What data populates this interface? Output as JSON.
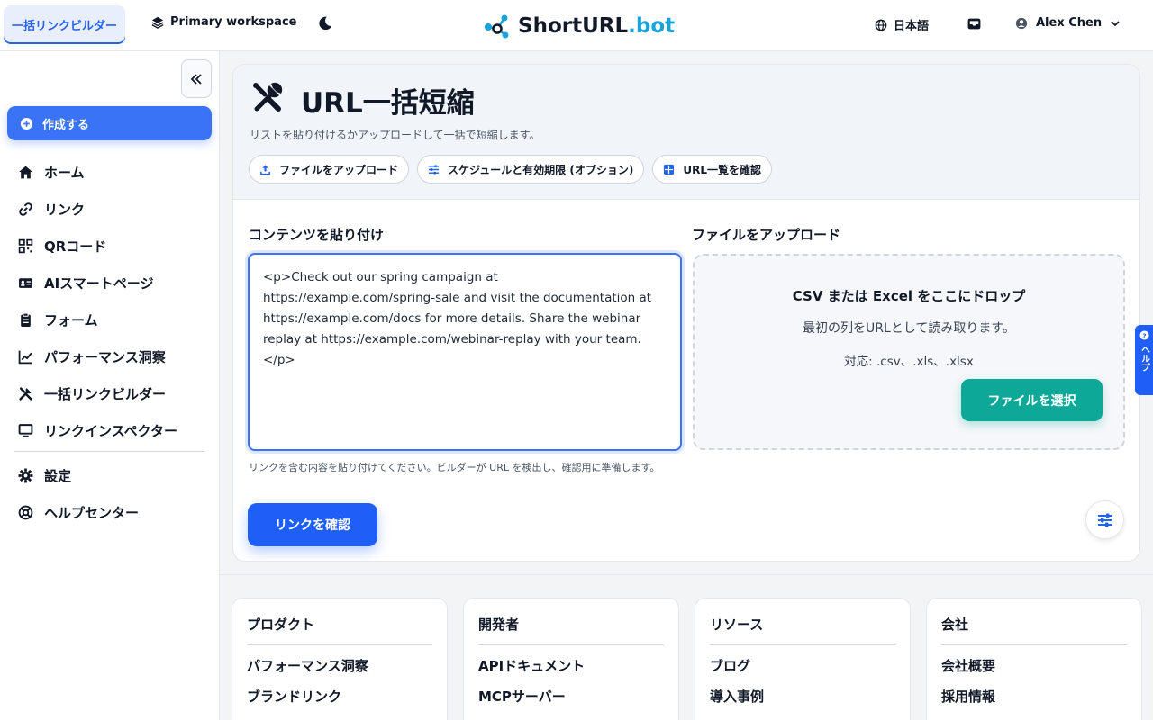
{
  "topbar": {
    "builder_tab": "一括リンクビルダー",
    "workspace": "Primary workspace",
    "logo_part1": "ShortURL",
    "logo_part2": ".bot",
    "language": "日本語",
    "user_name": "Alex Chen"
  },
  "sidebar": {
    "create_label": "作成する",
    "items": [
      {
        "label": "ホーム",
        "icon": "home-icon"
      },
      {
        "label": "リンク",
        "icon": "link-icon"
      },
      {
        "label": "QRコード",
        "icon": "qr-icon"
      },
      {
        "label": "AIスマートページ",
        "icon": "id-card-icon"
      },
      {
        "label": "フォーム",
        "icon": "clipboard-icon"
      },
      {
        "label": "パフォーマンス洞察",
        "icon": "chart-line-icon"
      },
      {
        "label": "一括リンクビルダー",
        "icon": "tools-icon"
      },
      {
        "label": "リンクインスペクター",
        "icon": "monitor-icon"
      }
    ],
    "secondary": [
      {
        "label": "設定",
        "icon": "gear-icon"
      },
      {
        "label": "ヘルプセンター",
        "icon": "lifebuoy-icon"
      }
    ]
  },
  "main": {
    "title": "URL一括短縮",
    "subtitle": "リストを貼り付けるかアップロードして一括で短縮します。",
    "chips": [
      "ファイルをアップロード",
      "スケジュールと有効期限 (オプション)",
      "URL一覧を確認"
    ],
    "paste_label": "コンテンツを貼り付け",
    "paste_value": "<p>Check out our spring campaign at https://example.com/spring-sale and visit the documentation at https://example.com/docs for more details. Share the webinar replay at https://example.com/webinar-replay with your team.</p>",
    "paste_hint": "リンクを含む内容を貼り付けてください。ビルダーが URL を検出し、確認用に準備します。",
    "confirm_button": "リンクを確認",
    "upload_label": "ファイルをアップロード",
    "drop_title": "CSV または Excel をここにドロップ",
    "drop_sub": "最初の列をURLとして読み取ります。",
    "drop_support": "対応: .csv、.xls、.xlsx",
    "select_button": "ファイルを選択"
  },
  "help_tab": "ヘルプ",
  "footer": {
    "columns": [
      {
        "title": "プロダクト",
        "links": [
          "パフォーマンス洞察",
          "ブランドリンク"
        ]
      },
      {
        "title": "開発者",
        "links": [
          "APIドキュメント",
          "MCPサーバー"
        ]
      },
      {
        "title": "リソース",
        "links": [
          "ブログ",
          "導入事例"
        ]
      },
      {
        "title": "会社",
        "links": [
          "会社概要",
          "採用情報"
        ]
      }
    ]
  },
  "colors": {
    "accent": "#3b73f6",
    "teal": "#0ea899",
    "logo_blue": "#1aa3d8"
  }
}
